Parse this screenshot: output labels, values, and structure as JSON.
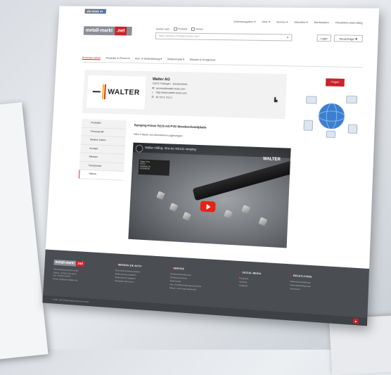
{
  "topbar": {
    "logo_text": "alu-news",
    "logo_mark": "de"
  },
  "topnav": [
    "Onlineausgaben ▾",
    "Über ▾",
    "Service ▾",
    "Aktuelles ▾",
    "Mediadaten",
    "Redaktion planmäßig"
  ],
  "header": {
    "logo_left": "metall-markt",
    "logo_right": ".net",
    "search_label": "Suchen nach",
    "opt_products": "Produkte",
    "opt_firms": "Firmen",
    "search_placeholder": "Nach welchem Produkt suchen Sie?",
    "login": "Login",
    "register": "Neuanfrage ✚"
  },
  "mainnav": [
    "Branchen-News",
    "Produkte & Firmen ▾",
    "Aus- & Weiterbildung ▾",
    "Stellenmarkt ▾",
    "Messen & Kongresse"
  ],
  "company": {
    "logo_text": "WALTER",
    "name": "Walter AG",
    "address": "72072 Tübingen - Deutschland",
    "email": "service@walter-tools.com",
    "web": "http://www.walter-tools.com",
    "phone": "49 7071 701-0",
    "follow": "Folgen"
  },
  "sidebar": [
    "Produkte",
    "Firmenprofil",
    "Weitere Daten",
    "Kontakt",
    "Messen",
    "Fachpresse",
    "Videos"
  ],
  "content": {
    "heading": "Ramping-Fräser R215 mit PVD Wendeschneidplatte",
    "sub": "HSC-Fräsen von Aluminium-Legierungen"
  },
  "video": {
    "title": "Walter milling: Xtra·tec M2131 ramping",
    "brand": "WALTER",
    "card_lines": [
      "Walter Tools",
      "M2131",
      "RAMPING IN",
      "ALUMINIUM"
    ]
  },
  "footer": {
    "logo_left": "metall-markt",
    "logo_right": ".net",
    "address": [
      "PSE Redaktionsservice GmbH",
      "Telefon: +49 8171 911 94-70",
      "Fax: +49 8171 30974",
      "E-mail: info@pse-redaktion.de"
    ],
    "col1_head": "WERDEN SIE AKTIV",
    "col1": [
      "Firmenbeschreibung anlegen",
      "Stellenanzeige aufgeben",
      "Stellengesuch aufgeben",
      "Newsletter abonnieren"
    ],
    "col2_head": "SERVICE",
    "col2": [
      "Fachverzeichnisbereich",
      "Produktverzeichnis",
      "Stellenmarkt",
      "Aus- und Weiterbildungsverzeichnis",
      "Messe- und Kongresskalender"
    ],
    "col3_head": "SOCIAL MEDIA",
    "col3": [
      "Facebook",
      "YouTube",
      "Instagram"
    ],
    "col4_head": "RECHTLICHES",
    "col4": [
      "Datenschutzerklärung",
      "Nutzungsbedingungen",
      "Impressum"
    ],
    "copyright": "© 1995 - 2022 PSE Redaktionsservice GmbH",
    "up": "▲"
  }
}
